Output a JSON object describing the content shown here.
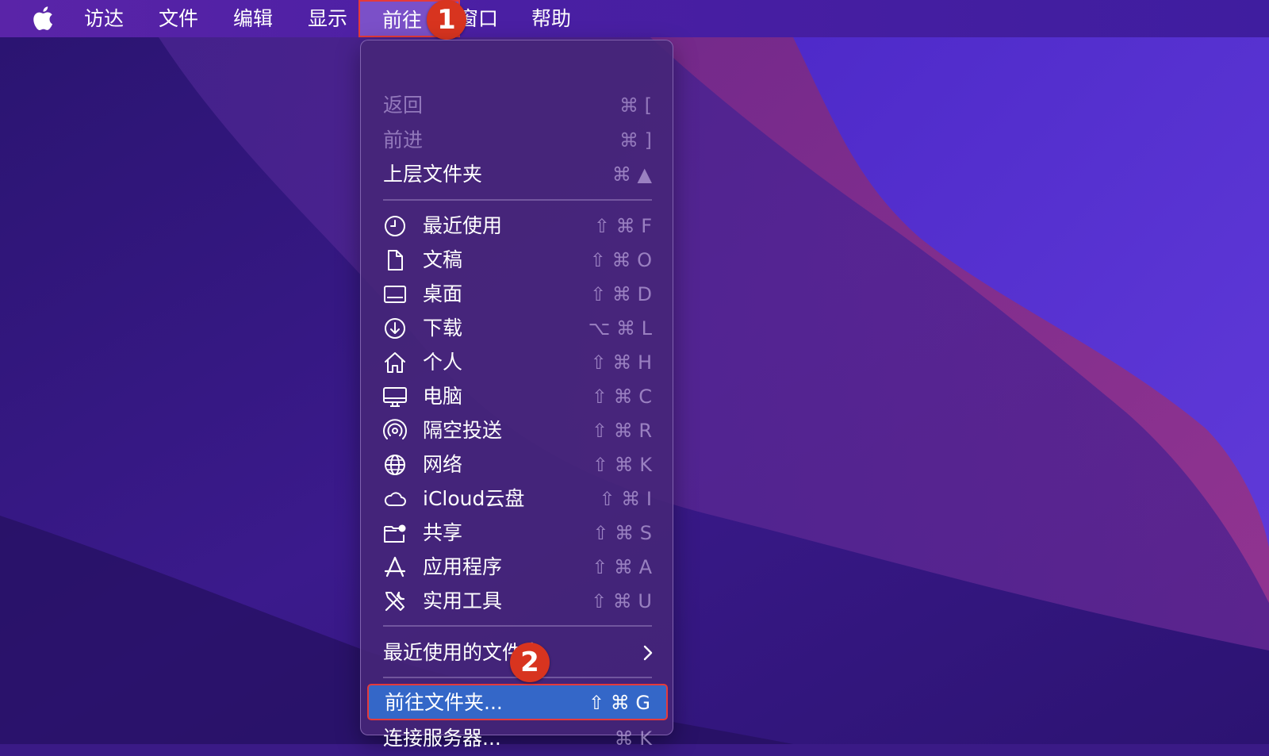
{
  "menubar": {
    "items": [
      {
        "label": "访达"
      },
      {
        "label": "文件"
      },
      {
        "label": "编辑"
      },
      {
        "label": "显示"
      },
      {
        "label": "前往"
      },
      {
        "label": "窗口"
      },
      {
        "label": "帮助"
      }
    ]
  },
  "badges": [
    "1",
    "2"
  ],
  "go_menu": {
    "back": {
      "label": "返回",
      "shortcut": "⌘ ["
    },
    "forward": {
      "label": "前进",
      "shortcut": "⌘ ]"
    },
    "enclosing": {
      "label": "上层文件夹",
      "shortcut": "⌘ ▲"
    },
    "places": [
      {
        "label": "最近使用",
        "shortcut": "⇧ ⌘ F",
        "icon": "clock-icon"
      },
      {
        "label": "文稿",
        "shortcut": "⇧ ⌘ O",
        "icon": "document-icon"
      },
      {
        "label": "桌面",
        "shortcut": "⇧ ⌘ D",
        "icon": "desktop-icon"
      },
      {
        "label": "下载",
        "shortcut": "⌥ ⌘ L",
        "icon": "download-icon"
      },
      {
        "label": "个人",
        "shortcut": "⇧ ⌘ H",
        "icon": "home-icon"
      },
      {
        "label": "电脑",
        "shortcut": "⇧ ⌘ C",
        "icon": "computer-icon"
      },
      {
        "label": "隔空投送",
        "shortcut": "⇧ ⌘ R",
        "icon": "airdrop-icon"
      },
      {
        "label": "网络",
        "shortcut": "⇧ ⌘ K",
        "icon": "network-globe-icon"
      },
      {
        "label": "iCloud云盘",
        "shortcut": "⇧ ⌘ I",
        "icon": "cloud-icon"
      },
      {
        "label": "共享",
        "shortcut": "⇧ ⌘ S",
        "icon": "shared-folder-icon"
      },
      {
        "label": "应用程序",
        "shortcut": "⇧ ⌘ A",
        "icon": "applications-icon"
      },
      {
        "label": "实用工具",
        "shortcut": "⇧ ⌘ U",
        "icon": "utilities-tools-icon"
      }
    ],
    "recent_folders": {
      "label": "最近使用的文件夹"
    },
    "go_to_folder": {
      "label": "前往文件夹...",
      "shortcut": "⇧ ⌘ G"
    },
    "connect_server": {
      "label": "连接服务器...",
      "shortcut": "⌘ K"
    }
  }
}
